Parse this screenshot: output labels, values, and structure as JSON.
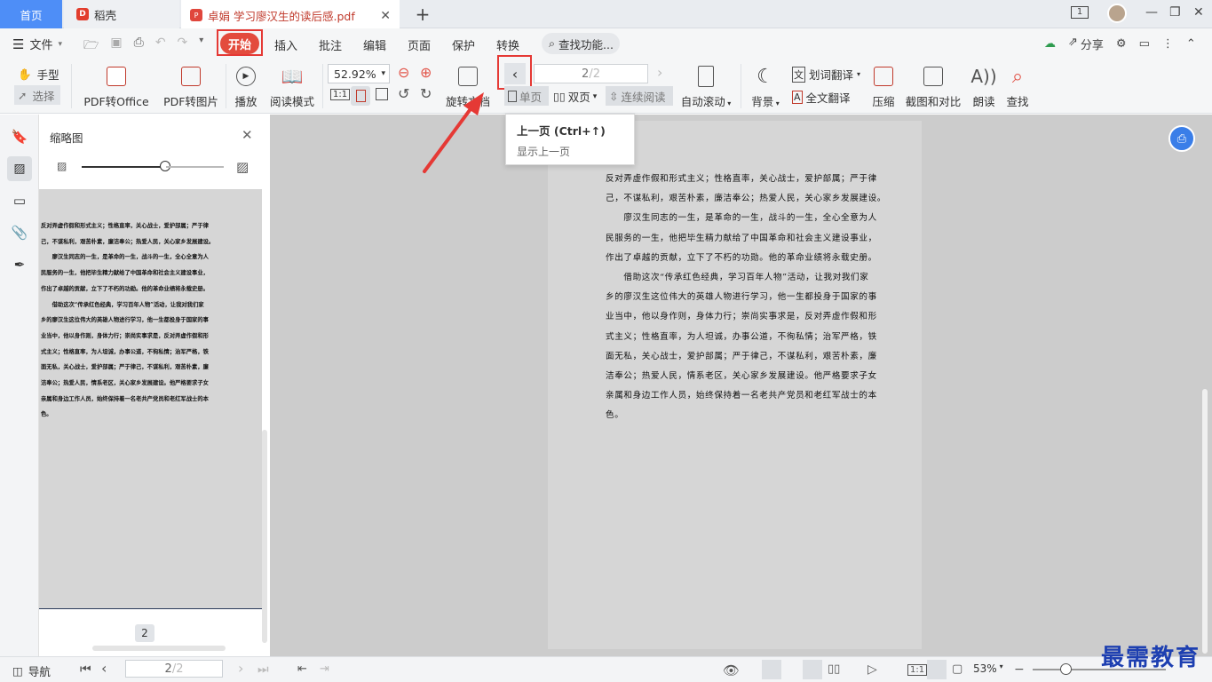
{
  "tabs": {
    "home": "首页",
    "daoke": "稻壳",
    "document": "卓娟 学习廖汉生的读后感.pdf"
  },
  "window": {
    "page_indicator": "1"
  },
  "menu": {
    "file": "文件",
    "items": [
      "开始",
      "插入",
      "批注",
      "编辑",
      "页面",
      "保护",
      "转换"
    ],
    "search": "查找功能...",
    "share": "分享"
  },
  "ribbon": {
    "hand": "手型",
    "select": "选择",
    "pdf_to_office": "PDF转Office",
    "pdf_to_image": "PDF转图片",
    "play": "播放",
    "read_mode": "阅读模式",
    "zoom": "52.92%",
    "rotate": "旋转文档",
    "page_current": "2",
    "page_total": "/2",
    "single": "单页",
    "double": "双页",
    "continuous": "连续阅读",
    "auto_scroll": "自动滚动",
    "background": "背景",
    "word_translate": "划词翻译",
    "full_translate": "全文翻译",
    "compress": "压缩",
    "screenshot_compare": "截图和对比",
    "read_aloud": "朗读",
    "find": "查找"
  },
  "tooltip": {
    "title": "上一页 (Ctrl+↑)",
    "desc": "显示上一页"
  },
  "thumbnail": {
    "title": "缩略图",
    "page_label": "2",
    "lines": [
      "反对弄虚作假和形式主义；性格直率，关心战士，爱护部属；严于律",
      "己，不谋私利，艰苦朴素，廉洁奉公；热爱人民，关心家乡发展建设。",
      "　　廖汉生同志的一生，是革命的一生，战斗的一生，全心全意为人",
      "民服务的一生，他把毕生精力献给了中国革命和社会主义建设事业，",
      "作出了卓越的贡献，立下了不朽的功勋。他的革命业绩将永载史册。",
      "　　借助这次“传承红色经典，学习百年人物”活动，让我对我们家",
      "乡的廖汉生这位伟大的英雄人物进行学习，他一生都投身于国家的事",
      "业当中，他以身作则，身体力行；崇尚实事求是，反对弄虚作假和形",
      "式主义；性格直率，为人坦诚，办事公道，不徇私情；治军严格，铁",
      "面无私，关心战士，爱护部属；严于律己，不谋私利，艰苦朴素，廉",
      "洁奉公；热爱人民，情系老区，关心家乡发展建设。他严格要求子女",
      "亲属和身边工作人员，始终保持着一名老共产党员和老红军战士的本",
      "色。"
    ]
  },
  "document": {
    "lines": [
      "反对弄虚作假和形式主义；性格直率，关心战士，爱护部属；严于律",
      "己，不谋私利，艰苦朴素，廉洁奉公；热爱人民，关心家乡发展建设。",
      "　　廖汉生同志的一生，是革命的一生，战斗的一生，全心全意为人",
      "民服务的一生，他把毕生精力献给了中国革命和社会主义建设事业，",
      "作出了卓越的贡献，立下了不朽的功勋。他的革命业绩将永载史册。",
      "　　借助这次“传承红色经典，学习百年人物”活动，让我对我们家",
      "乡的廖汉生这位伟大的英雄人物进行学习，他一生都投身于国家的事",
      "业当中，他以身作则，身体力行；崇尚实事求是，反对弄虚作假和形",
      "式主义；性格直率，为人坦诚，办事公道，不徇私情；治军严格，铁",
      "面无私，关心战士，爱护部属；严于律己，不谋私利，艰苦朴素，廉",
      "洁奉公；热爱人民，情系老区，关心家乡发展建设。他严格要求子女",
      "亲属和身边工作人员，始终保持着一名老共产党员和老红军战士的本",
      "色。"
    ]
  },
  "status": {
    "nav": "导航",
    "page_current": "2",
    "page_total": "/2",
    "zoom": "53%"
  },
  "watermark": "最需教育"
}
